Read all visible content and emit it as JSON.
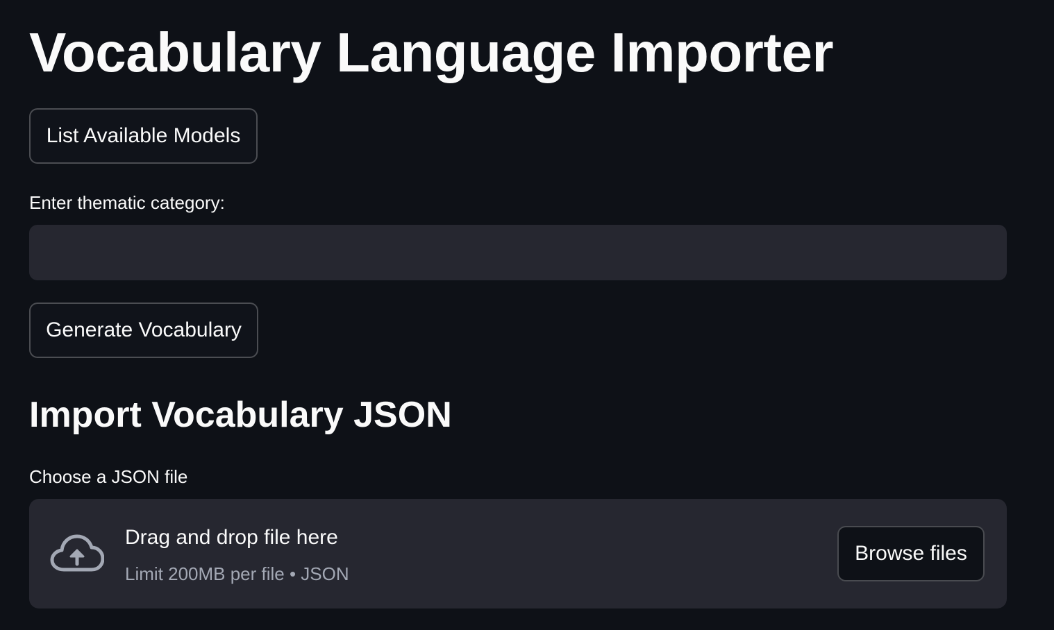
{
  "page": {
    "title": "Vocabulary Language Importer"
  },
  "actions": {
    "list_models_label": "List Available Models",
    "generate_label": "Generate Vocabulary"
  },
  "category_input": {
    "label": "Enter thematic category:",
    "value": "",
    "placeholder": ""
  },
  "import_section": {
    "heading": "Import Vocabulary JSON",
    "file_label": "Choose a JSON file",
    "dropzone": {
      "icon": "cloud-upload-icon",
      "primary_text": "Drag and drop file here",
      "secondary_text": "Limit 200MB per file • JSON",
      "browse_label": "Browse files"
    }
  },
  "colors": {
    "background": "#0e1117",
    "surface": "#262730",
    "text": "#fafafa",
    "muted_text": "#a3a8b4"
  }
}
